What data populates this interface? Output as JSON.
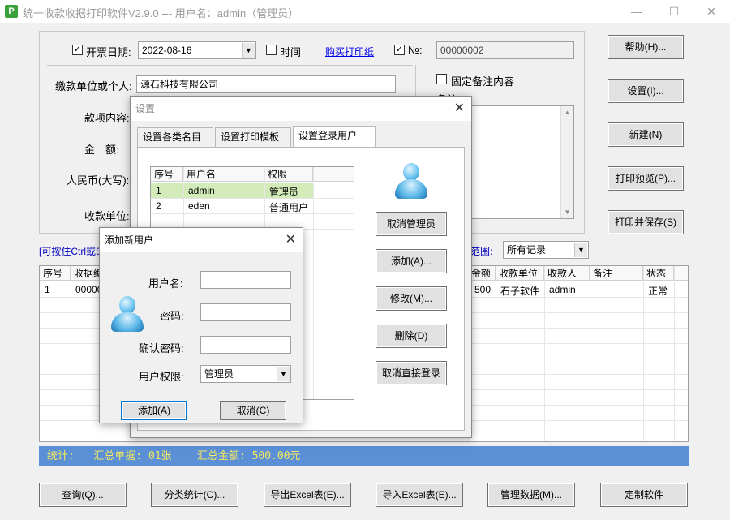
{
  "window": {
    "title": "统一收款收据打印软件V2.9.0 --- 用户名：admin（管理员）",
    "icon_letter": "P",
    "minimize": "—",
    "maximize": "☐",
    "close": "✕"
  },
  "form": {
    "issue_date_checked": true,
    "issue_date_label": "开票日期:",
    "issue_date_value": "2022-08-16",
    "time_checked": false,
    "time_label": "时间",
    "buy_paper_link": "购买打印纸",
    "no_checked": true,
    "no_label": "№:",
    "no_value": "00000002",
    "payer_label": "缴款单位或个人:",
    "payer_value": "源石科技有限公司",
    "item_label": "款项内容:",
    "amount_label": "金　额:",
    "rmb_label": "人民币(大写):",
    "receiver_label": "收款单位:",
    "fixed_note_checked": false,
    "fixed_note_label": "固定备注内容",
    "note_label": "备注:"
  },
  "right_buttons": {
    "help": "帮助(H)...",
    "settings": "设置(I)...",
    "new": "新建(N)",
    "print_preview": "打印预览(P)...",
    "print_save": "打印并保存(S)"
  },
  "filter": {
    "hint": "[可按住Ctrl或S",
    "range_label": "范围:",
    "range_value": "所有记录"
  },
  "records": {
    "columns_left": [
      "序号",
      "收据编"
    ],
    "columns_right": [
      "金额",
      "收款单位",
      "收款人",
      "备注",
      "状态"
    ],
    "rows": [
      {
        "seq": "1",
        "num": "00000",
        "amount": "500",
        "unit": "石子软件",
        "payee": "admin",
        "note": "",
        "status": "正常"
      }
    ]
  },
  "status_bar": {
    "text": "统计:   汇总单据: 01张    汇总金额: 500.00元"
  },
  "bottom_buttons": {
    "query": "查询(Q)...",
    "category_stats": "分类统计(C)...",
    "export_excel": "导出Excel表(E)...",
    "import_excel": "导入Excel表(E)...",
    "manage_data": "管理数据(M)...",
    "customize": "定制软件"
  },
  "settings_dialog": {
    "title": "设置",
    "close": "✕",
    "tabs": [
      "设置各类名目",
      "设置打印模板",
      "设置登录用户"
    ],
    "active_tab": 2,
    "user_columns": [
      "序号",
      "用户名",
      "权限"
    ],
    "users": [
      {
        "seq": "1",
        "name": "admin",
        "role": "管理员"
      },
      {
        "seq": "2",
        "name": "eden",
        "role": "普通用户"
      }
    ],
    "buttons": {
      "cancel_admin": "取消管理员",
      "add": "添加(A)...",
      "modify": "修改(M)...",
      "delete": "删除(D)",
      "cancel_direct_login": "取消直接登录"
    }
  },
  "add_user_dialog": {
    "title": "添加新用户",
    "close": "✕",
    "username_label": "用户名:",
    "username_value": "",
    "password_label": "密码:",
    "password_value": "",
    "confirm_label": "确认密码:",
    "confirm_value": "",
    "role_label": "用户权限:",
    "role_value": "管理员",
    "add_button": "添加(A)",
    "cancel_button": "取消(C)"
  },
  "colors": {
    "status_bar_bg": "#5b8fd6",
    "status_bar_text": "#f5e860",
    "selected_row": "#d2ebb8",
    "link": "#0000ee",
    "default_button_border": "#0078d7"
  }
}
